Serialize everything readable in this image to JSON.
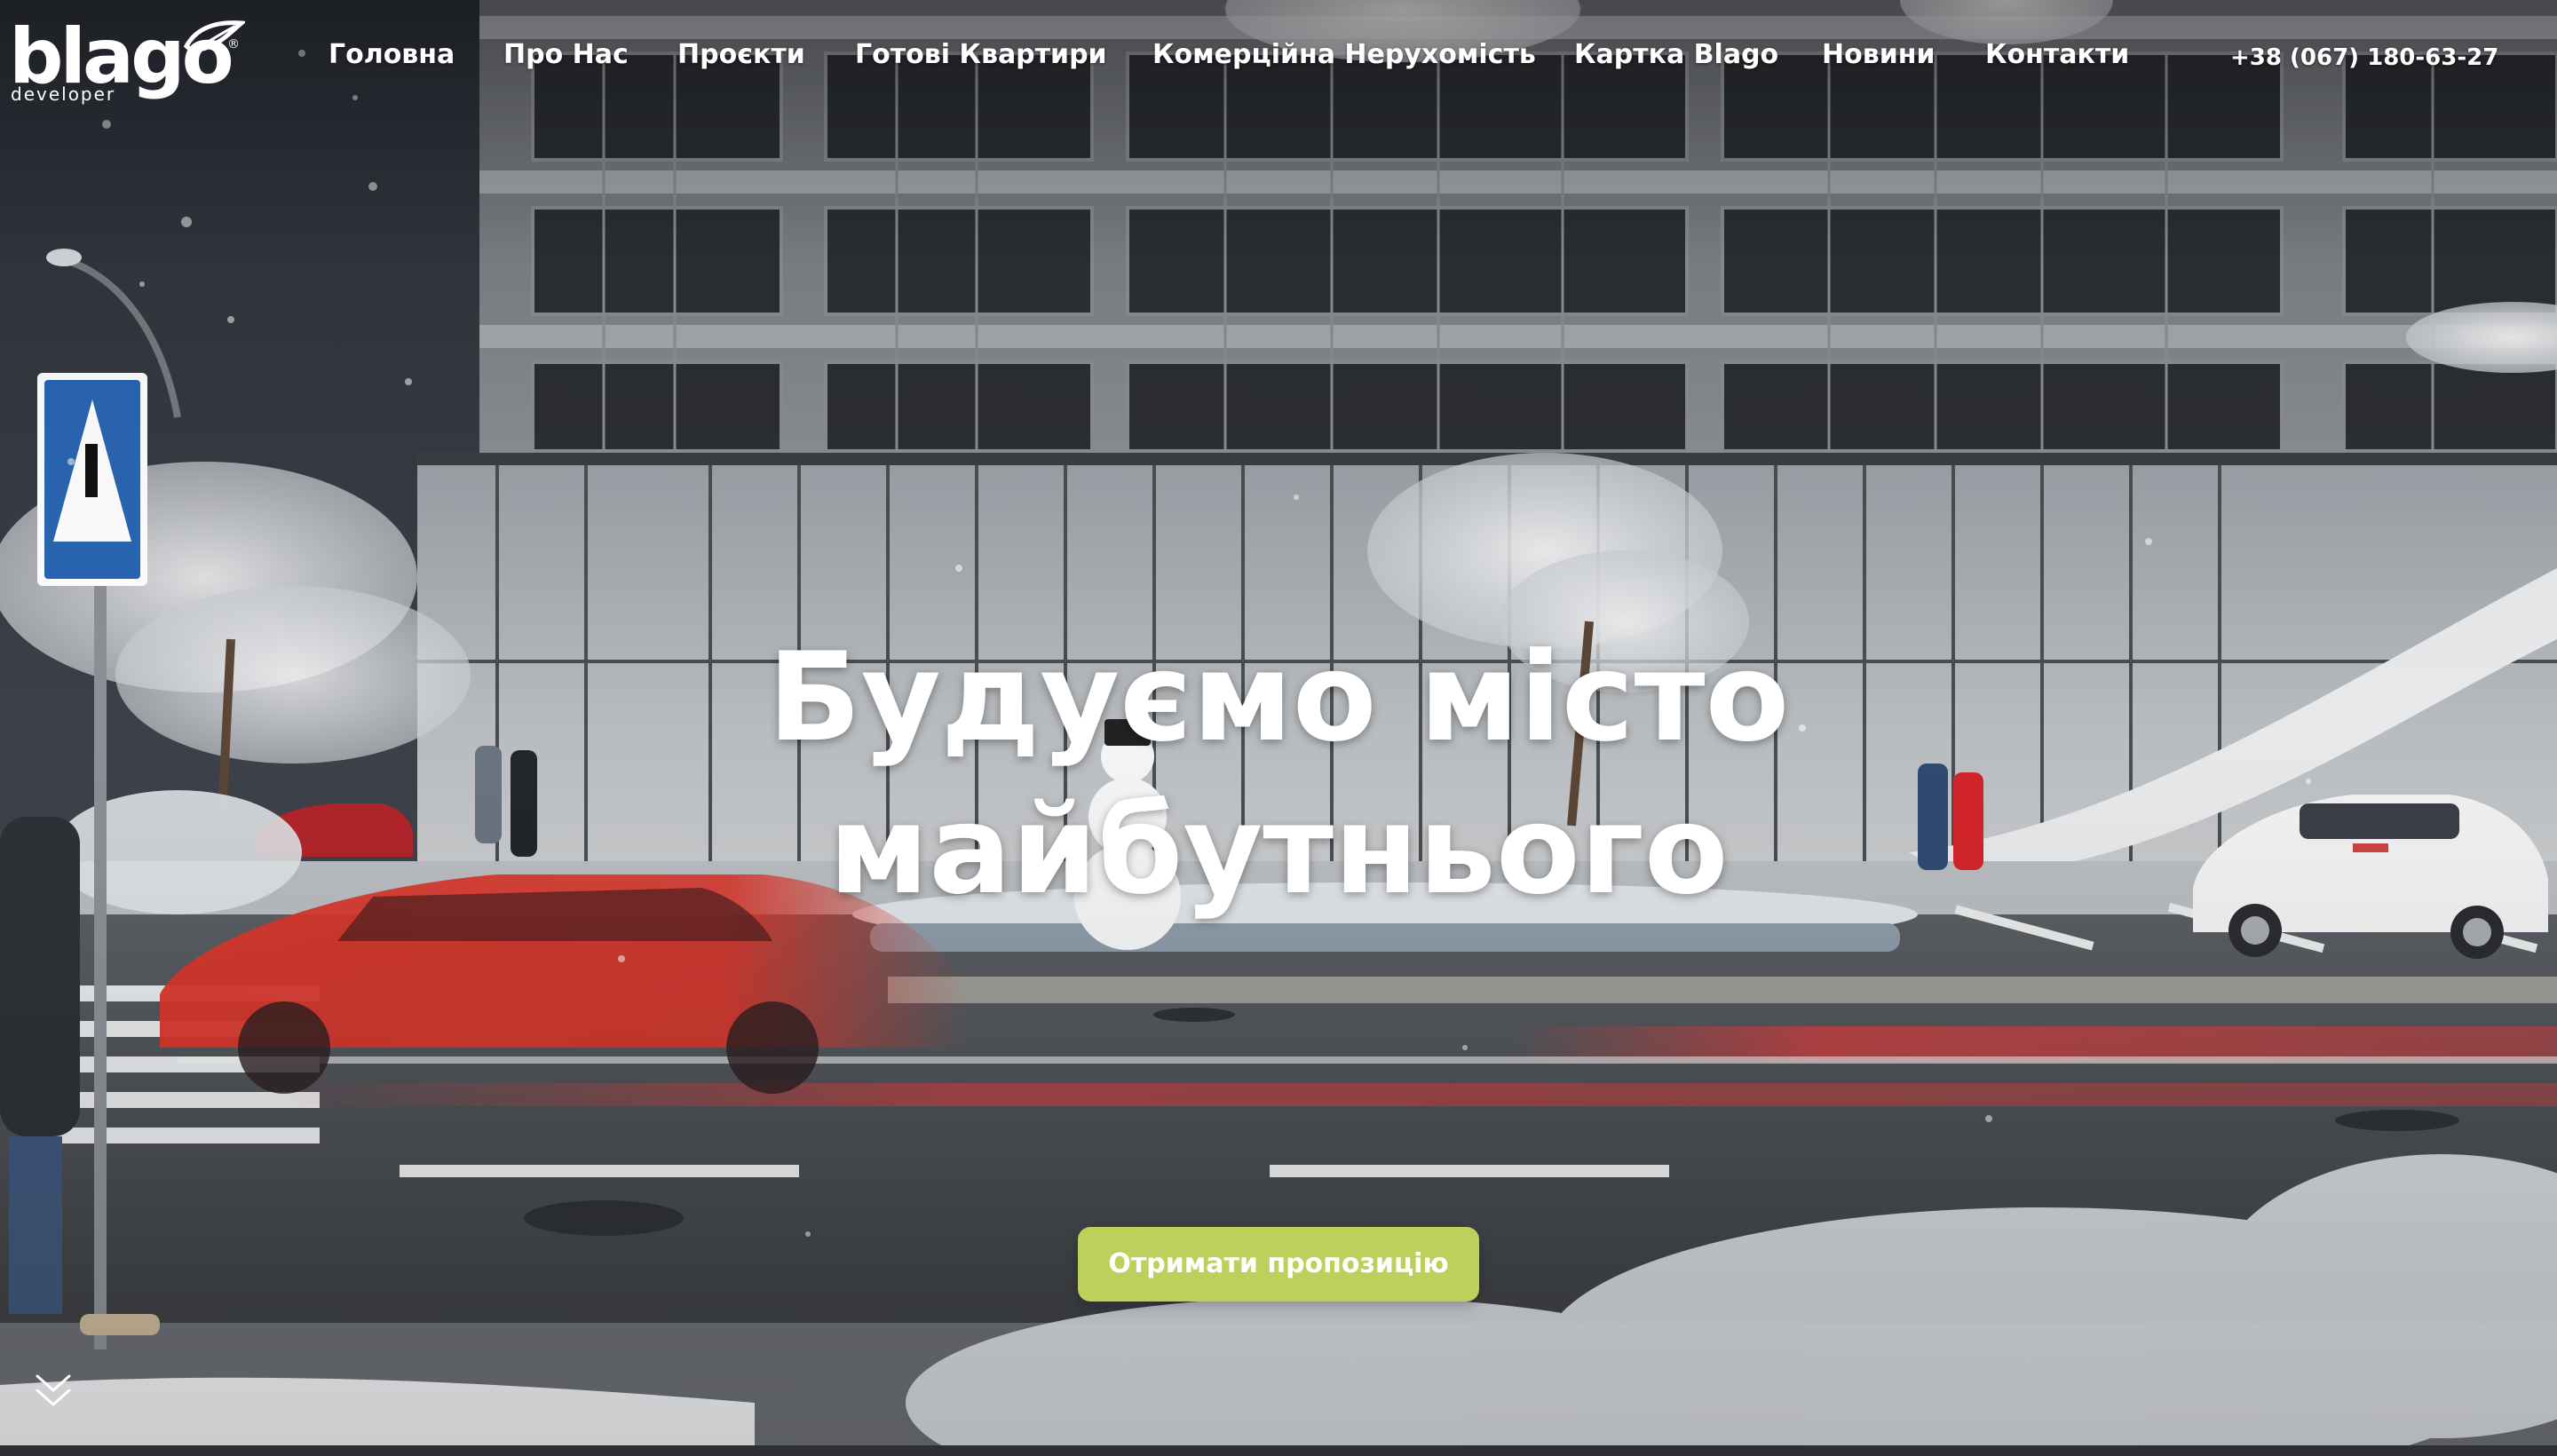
{
  "brand": {
    "logo_text": "blago",
    "logo_subtext": "developer",
    "logo_reg": "®"
  },
  "nav": {
    "items": [
      {
        "label": "Головна"
      },
      {
        "label": "Про Нас"
      },
      {
        "label": "Проєкти"
      },
      {
        "label": "Готові Квартири"
      },
      {
        "label": "Комерційна Нерухомість"
      },
      {
        "label": "Картка Blago"
      },
      {
        "label": "Новини"
      },
      {
        "label": "Контакти"
      }
    ],
    "phone": "+38 (067) 180-63-27"
  },
  "hero": {
    "title_line1": "Будуємо місто",
    "title_line2": "майбутнього",
    "cta_label": "Отримати пропозицію"
  },
  "icons": {
    "scroll": "chevron-double-down-icon",
    "brand_leaf": "leaf-icon"
  },
  "colors": {
    "accent": "#bdd05c",
    "text": "#ffffff"
  }
}
